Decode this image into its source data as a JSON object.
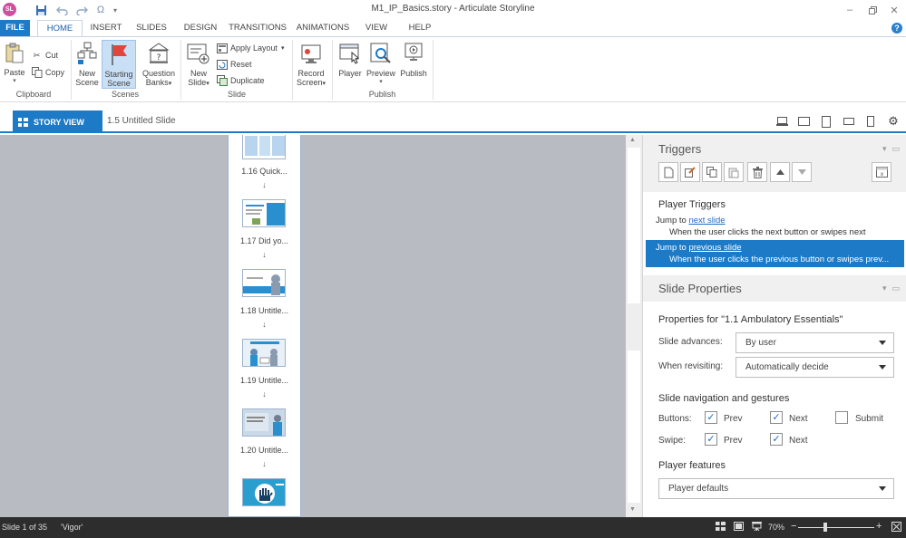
{
  "titlebar": {
    "logo_text": "SL",
    "title": "M1_IP_Basics.story - Articulate Storyline",
    "qat_icons": [
      "save-icon",
      "undo-icon",
      "redo-icon",
      "symbol-icon",
      "customize-icon"
    ],
    "window_controls": [
      "minimize",
      "restore",
      "close"
    ]
  },
  "ribbon_tabs": [
    "FILE",
    "HOME",
    "INSERT",
    "SLIDES",
    "DESIGN",
    "TRANSITIONS",
    "ANIMATIONS",
    "VIEW",
    "HELP"
  ],
  "active_tab": "HOME",
  "help_glyph": "?",
  "ribbon": {
    "clipboard": {
      "paste": "Paste",
      "cut": "Cut",
      "copy": "Copy",
      "group": "Clipboard"
    },
    "scenes": {
      "new_scene_1": "New",
      "new_scene_2": "Scene",
      "starting_scene_1": "Starting",
      "starting_scene_2": "Scene",
      "question_banks_1": "Question",
      "question_banks_2": "Banks",
      "group": "Scenes"
    },
    "slide": {
      "new_slide_1": "New",
      "new_slide_2": "Slide",
      "apply_layout": "Apply Layout",
      "reset": "Reset",
      "duplicate": "Duplicate",
      "group": "Slide"
    },
    "record": {
      "record_1": "Record",
      "record_2": "Screen"
    },
    "publish": {
      "player": "Player",
      "preview": "Preview",
      "publish": "Publish",
      "group": "Publish"
    }
  },
  "viewbar": {
    "story_view": "STORY VIEW",
    "slide_tab": "1.5 Untitled Slide",
    "device_icons": [
      "desktop-icon",
      "tablet-landscape-icon",
      "tablet-portrait-icon",
      "phone-landscape-icon",
      "phone-portrait-icon",
      "settings-icon"
    ]
  },
  "scene_slides": [
    {
      "label": "1.16 Quick..."
    },
    {
      "label": "1.17 Did yo..."
    },
    {
      "label": "1.18 Untitle..."
    },
    {
      "label": "1.19 Untitle..."
    },
    {
      "label": "1.20 Untitle..."
    }
  ],
  "flow_arrow": "↓",
  "triggers": {
    "title": "Triggers",
    "player_triggers": "Player Triggers",
    "items": [
      {
        "prefix": "Jump to",
        "link": "next slide",
        "sub": "When the user clicks the next button or swipes next",
        "selected": false
      },
      {
        "prefix": "Jump to",
        "link": "previous slide",
        "sub": "When the user clicks the previous button or swipes prev...",
        "selected": true
      }
    ]
  },
  "slide_properties": {
    "title": "Slide Properties",
    "properties_for": "Properties for \"1.1 Ambulatory Essentials\"",
    "slide_advances_label": "Slide advances:",
    "slide_advances_value": "By user",
    "when_revisiting_label": "When revisiting:",
    "when_revisiting_value": "Automatically decide",
    "nav_heading": "Slide navigation and gestures",
    "buttons_label": "Buttons:",
    "swipe_label": "Swipe:",
    "buttons": {
      "prev": {
        "label": "Prev",
        "checked": true
      },
      "next": {
        "label": "Next",
        "checked": true
      },
      "submit": {
        "label": "Submit",
        "checked": false
      }
    },
    "swipe": {
      "prev": {
        "label": "Prev",
        "checked": true
      },
      "next": {
        "label": "Next",
        "checked": true
      }
    },
    "player_features_heading": "Player features",
    "player_features_value": "Player defaults"
  },
  "statusbar": {
    "slide_count": "Slide 1 of 35",
    "theme": "'Vigor'",
    "zoom": "70%",
    "zoom_level_percent": 70,
    "minus": "−",
    "plus": "+"
  },
  "colors": {
    "accent": "#1d7ac6",
    "canvas": "#b8bcc2",
    "statusbar": "#2d2d2d"
  }
}
